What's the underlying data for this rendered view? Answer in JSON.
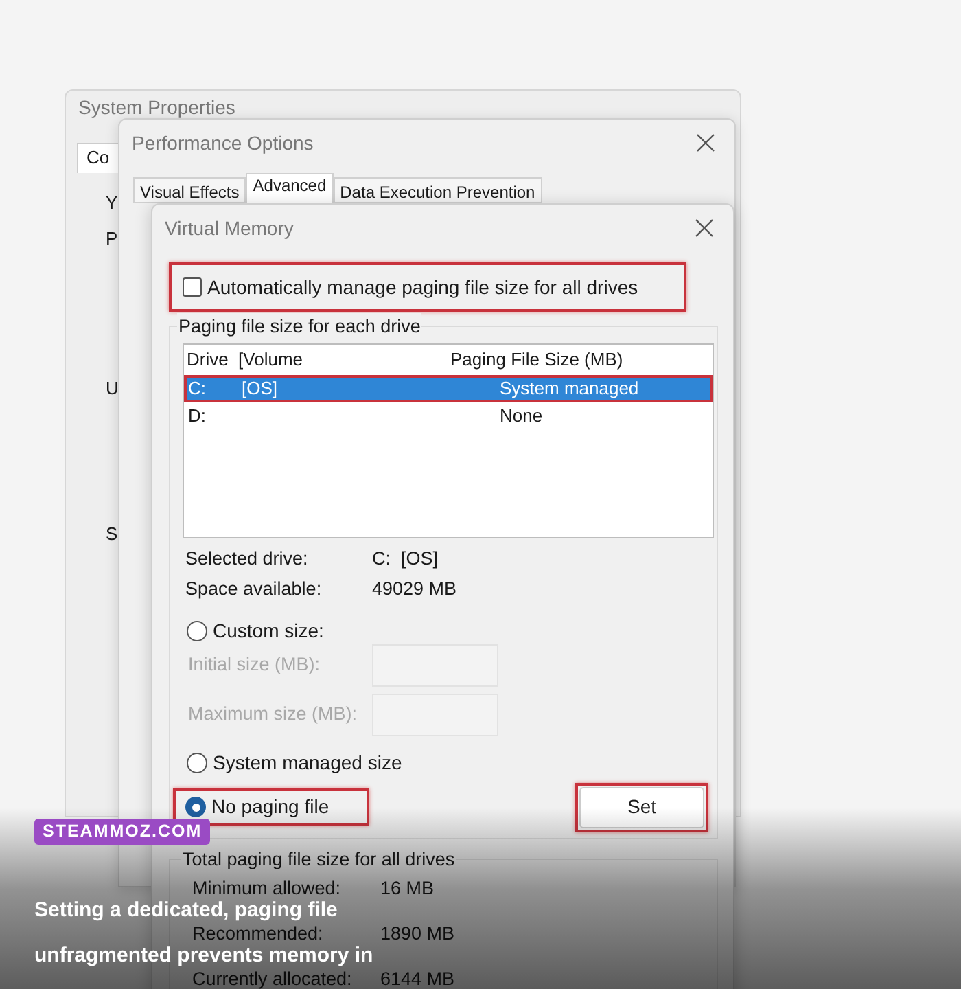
{
  "system_properties": {
    "title": "System Properties",
    "tab": "Co",
    "fragments": [
      "Y",
      "P",
      "U",
      "S"
    ]
  },
  "performance_options": {
    "title": "Performance Options",
    "tabs": [
      {
        "label": "Visual Effects",
        "selected": false
      },
      {
        "label": "Advanced",
        "selected": true
      },
      {
        "label": "Data Execution Prevention",
        "selected": false
      }
    ]
  },
  "virtual_memory": {
    "title": "Virtual Memory",
    "auto_manage": {
      "label": "Automatically manage paging file size for all drives",
      "checked": false,
      "highlighted": true
    },
    "drives_group": {
      "title": "Paging file size for each drive",
      "columns": [
        "Drive  [Volume",
        "Paging File Size (MB)"
      ],
      "rows": [
        {
          "drive": "C:",
          "volume": "[OS]",
          "size": "System managed",
          "selected": true,
          "highlighted": true
        },
        {
          "drive": "D:",
          "size": "None",
          "selected": false,
          "highlighted": false
        }
      ]
    },
    "details": [
      {
        "label": "Selected drive:",
        "value": "C:  [OS]"
      },
      {
        "label": "Space available:",
        "value": "49029 MB"
      }
    ],
    "size_options": [
      {
        "kind": "radio",
        "label": "Custom size:",
        "selected": false,
        "highlighted": false
      },
      {
        "kind": "field",
        "label": "Initial size (MB):",
        "disabled": true
      },
      {
        "kind": "field",
        "label": "Maximum size (MB):",
        "disabled": true
      },
      {
        "kind": "radio",
        "label": "System managed size",
        "selected": false,
        "highlighted": false
      },
      {
        "kind": "radio",
        "label": "No paging file",
        "selected": true,
        "highlighted": true
      }
    ],
    "set_button": {
      "label": "Set",
      "highlighted": true
    },
    "totals": {
      "title": "Total paging file size for all drives",
      "rows": [
        {
          "label": "Minimum allowed:",
          "value": "16 MB"
        },
        {
          "label": "Recommended:",
          "value": "1890 MB"
        },
        {
          "label": "Currently allocated:",
          "value": "6144 MB"
        }
      ]
    }
  },
  "caption": {
    "badge": "STEAMMOZ.COM",
    "lines": [
      "Setting a dedicated, paging file",
      "unfragmented prevents memory in"
    ]
  }
}
